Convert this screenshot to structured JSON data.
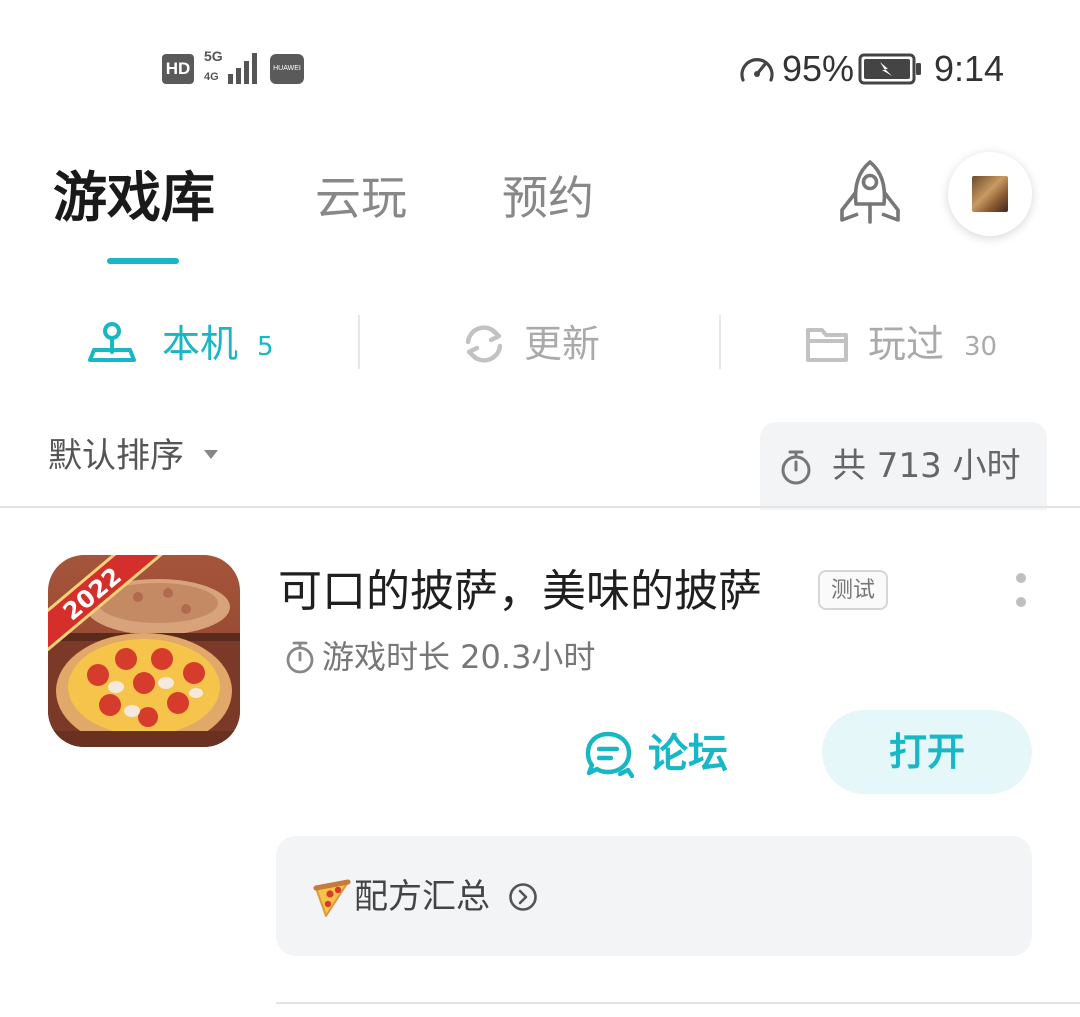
{
  "status_bar": {
    "hd_label": "HD",
    "network_label": "5G",
    "carrier_label": "HUAWEI",
    "battery_percent": "95%",
    "time": "9:14"
  },
  "top_tabs": {
    "items": [
      {
        "label": "游戏库",
        "active": true
      },
      {
        "label": "云玩",
        "active": false
      },
      {
        "label": "预约",
        "active": false
      }
    ],
    "rocket_icon": "rocket-icon",
    "avatar_icon": "user-avatar"
  },
  "segments": [
    {
      "label": "本机",
      "count": "5",
      "icon": "joystick-icon",
      "active": true
    },
    {
      "label": "更新",
      "count": "",
      "icon": "refresh-icon",
      "active": false
    },
    {
      "label": "玩过",
      "count": "30",
      "icon": "folder-icon",
      "active": false
    }
  ],
  "sort": {
    "label": "默认排序",
    "total_text": "共 713 小时"
  },
  "game": {
    "title": "可口的披萨，美味的披萨",
    "badge": "测试",
    "play_time": "游戏时长 20.3小时",
    "icon_year": "2022",
    "forum_label": "论坛",
    "open_label": "打开",
    "recipe_label": "配方汇总"
  },
  "colors": {
    "accent": "#18b7c6",
    "accent_light": "#e6f7f9",
    "muted": "#888888",
    "panel": "#f3f4f6"
  }
}
